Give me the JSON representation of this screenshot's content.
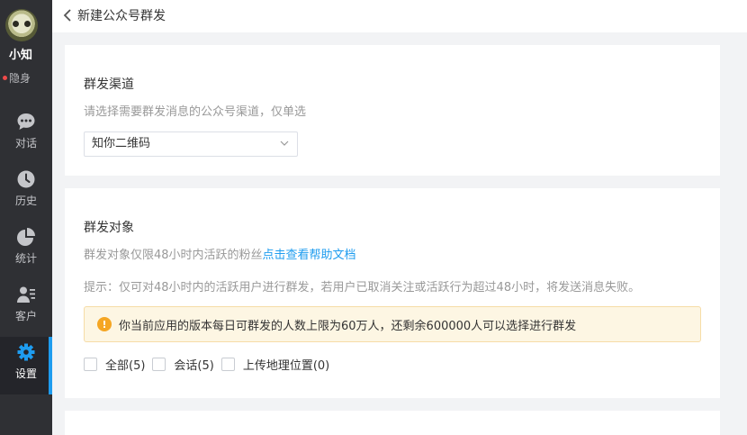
{
  "user": {
    "name": "小知",
    "status": "隐身"
  },
  "nav": [
    {
      "id": "chat",
      "label": "对话",
      "icon": "chat-bubble-icon"
    },
    {
      "id": "history",
      "label": "历史",
      "icon": "clock-icon"
    },
    {
      "id": "stats",
      "label": "统计",
      "icon": "pie-chart-icon"
    },
    {
      "id": "customers",
      "label": "客户",
      "icon": "user-list-icon"
    },
    {
      "id": "settings",
      "label": "设置",
      "icon": "gear-icon",
      "active": true
    }
  ],
  "header": {
    "back_title": "新建公众号群发"
  },
  "channel": {
    "title": "群发渠道",
    "hint": "请选择需要群发消息的公众号渠道，仅单选",
    "selected": "知你二维码"
  },
  "target": {
    "title": "群发对象",
    "hint_prefix": "群发对象仅限48小时内活跃的粉丝",
    "help_link": "点击查看帮助文档",
    "tip": "提示：仅可对48小时内的活跃用户进行群发，若用户已取消关注或活跃行为超过48小时，将发送消息失败。",
    "notice": "你当前应用的版本每日可群发的人数上限为60万人，还剩余600000人可以选择进行群发",
    "options": [
      {
        "label": "全部(5)",
        "checked": false
      },
      {
        "label": "会话(5)",
        "checked": false
      },
      {
        "label": "上传地理位置(0)",
        "checked": false
      }
    ]
  },
  "colors": {
    "sidebar": "#2f3034",
    "accent": "#1e9cef",
    "warning": "#f5a623"
  }
}
